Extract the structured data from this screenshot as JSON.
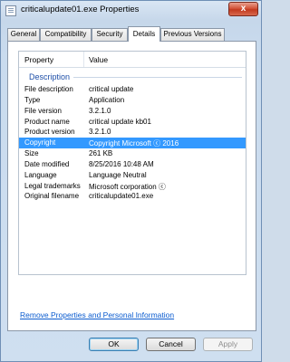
{
  "window": {
    "title": "criticalupdate01.exe Properties",
    "close_label": "x"
  },
  "tabs": [
    {
      "label": "General"
    },
    {
      "label": "Compatibility"
    },
    {
      "label": "Security"
    },
    {
      "label": "Details"
    },
    {
      "label": "Previous Versions"
    }
  ],
  "details": {
    "col_property": "Property",
    "col_value": "Value",
    "group": "Description",
    "rows": [
      {
        "property": "File description",
        "value": "critical update"
      },
      {
        "property": "Type",
        "value": "Application"
      },
      {
        "property": "File version",
        "value": "3.2.1.0"
      },
      {
        "property": "Product name",
        "value": "critical update kb01"
      },
      {
        "property": "Product version",
        "value": "3.2.1.0"
      },
      {
        "property": "Copyright",
        "value": "Copyright Microsoft ⓒ  2016"
      },
      {
        "property": "Size",
        "value": "261 KB"
      },
      {
        "property": "Date modified",
        "value": "8/25/2016 10:48 AM"
      },
      {
        "property": "Language",
        "value": "Language Neutral"
      },
      {
        "property": "Legal trademarks",
        "value": "Microsoft  corporation ⓒ"
      },
      {
        "property": "Original filename",
        "value": "criticalupdate01.exe"
      }
    ],
    "selected_row": "Copyright"
  },
  "remove_link": "Remove Properties and Personal Information",
  "buttons": {
    "ok": "OK",
    "cancel": "Cancel",
    "apply": "Apply"
  }
}
